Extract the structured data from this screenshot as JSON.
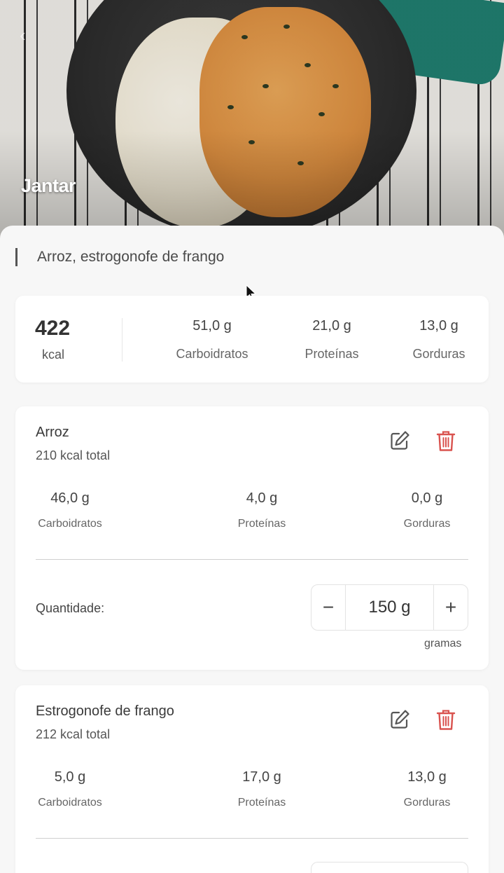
{
  "meal": {
    "title": "Jantar",
    "description": "Arroz, estrogonofe de frango"
  },
  "summary": {
    "kcal_value": "422",
    "kcal_label": "kcal",
    "macros": [
      {
        "value": "51,0 g",
        "label": "Carboidratos"
      },
      {
        "value": "21,0 g",
        "label": "Proteínas"
      },
      {
        "value": "13,0 g",
        "label": "Gorduras"
      }
    ]
  },
  "foods": [
    {
      "name": "Arroz",
      "kcal_total": "210 kcal total",
      "macros": [
        {
          "value": "46,0 g",
          "label": "Carboidratos"
        },
        {
          "value": "4,0 g",
          "label": "Proteínas"
        },
        {
          "value": "0,0 g",
          "label": "Gorduras"
        }
      ],
      "quantity_label": "Quantidade:",
      "quantity_value": "150 g",
      "unit": "gramas",
      "minus": "−",
      "plus": "+"
    },
    {
      "name": "Estrogonofe de frango",
      "kcal_total": "212 kcal total",
      "macros": [
        {
          "value": "5,0 g",
          "label": "Carboidratos"
        },
        {
          "value": "17,0 g",
          "label": "Proteínas"
        },
        {
          "value": "13,0 g",
          "label": "Gorduras"
        }
      ]
    }
  ],
  "icons": {
    "edit": "edit-icon",
    "delete": "trash-icon",
    "back": "back-arrow-icon"
  },
  "colors": {
    "delete": "#d9534f",
    "edit": "#555555"
  }
}
